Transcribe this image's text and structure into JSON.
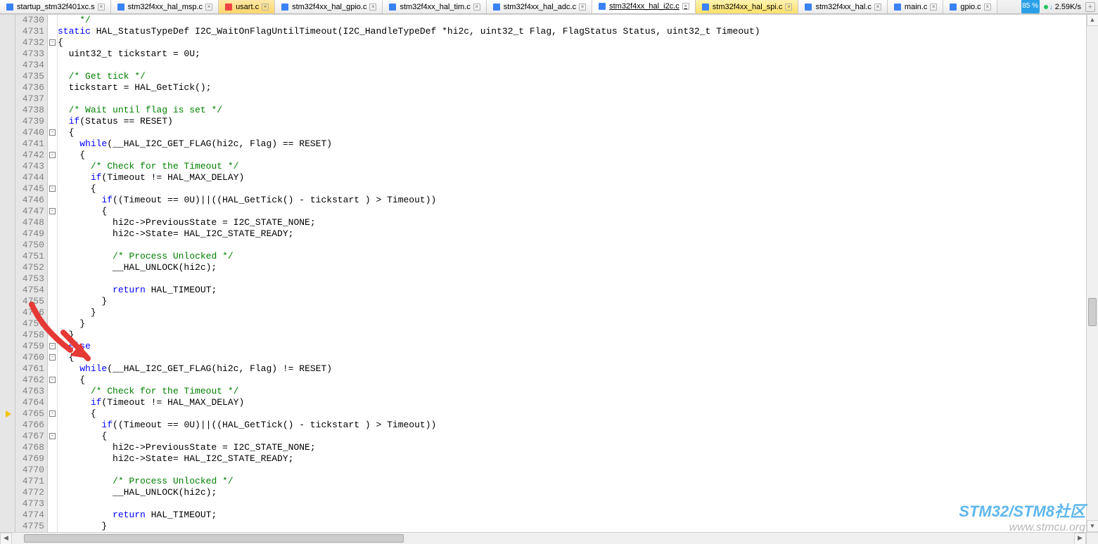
{
  "tabs": [
    {
      "label": "startup_stm32f401xc.s",
      "color": "blue",
      "special": false,
      "active": false
    },
    {
      "label": "stm32f4xx_hal_msp.c",
      "color": "blue",
      "special": false,
      "active": false
    },
    {
      "label": "usart.c",
      "color": "red",
      "special": true,
      "active": false
    },
    {
      "label": "stm32f4xx_hal_gpio.c",
      "color": "blue",
      "special": false,
      "active": false
    },
    {
      "label": "stm32f4xx_hal_tim.c",
      "color": "blue",
      "special": false,
      "active": false
    },
    {
      "label": "stm32f4xx_hal_adc.c",
      "color": "blue",
      "special": false,
      "active": false
    },
    {
      "label": "stm32f4xx_hal_i2c.c",
      "color": "blue",
      "special": false,
      "active": true
    },
    {
      "label": "stm32f4xx_hal_spi.c",
      "color": "blue",
      "special": true,
      "active": false
    },
    {
      "label": "stm32f4xx_hal.c",
      "color": "blue",
      "special": false,
      "active": false
    },
    {
      "label": "main.c",
      "color": "blue",
      "special": false,
      "active": false
    },
    {
      "label": "gpio.c",
      "color": "blue",
      "special": false,
      "active": false
    }
  ],
  "status": {
    "pct": "85 %",
    "speed": "2.59K/s"
  },
  "first_line_number": 4730,
  "breakpoint_line": 4765,
  "fold_lines": [
    4732,
    4740,
    4742,
    4745,
    4747,
    4759,
    4760,
    4762,
    4765,
    4767
  ],
  "code_lines": [
    {
      "n": 4730,
      "raw": "    */",
      "seg": [
        [
          "cmt",
          "    */"
        ]
      ]
    },
    {
      "n": 4731,
      "raw": "static HAL_StatusTypeDef I2C_WaitOnFlagUntilTimeout(I2C_HandleTypeDef *hi2c, uint32_t Flag, FlagStatus Status, uint32_t Timeout)",
      "seg": [
        [
          "kw",
          "static"
        ],
        [
          "cn",
          " HAL_StatusTypeDef I2C_WaitOnFlagUntilTimeout(I2C_HandleTypeDef *hi2c, uint32_t Flag, FlagStatus Status, uint32_t Timeout)"
        ]
      ]
    },
    {
      "n": 4732,
      "raw": "{",
      "seg": [
        [
          "cn",
          "{"
        ]
      ]
    },
    {
      "n": 4733,
      "raw": "  uint32_t tickstart = 0U;",
      "seg": [
        [
          "cn",
          "  uint32_t tickstart = 0U;"
        ]
      ]
    },
    {
      "n": 4734,
      "raw": "",
      "seg": [
        [
          "cn",
          ""
        ]
      ]
    },
    {
      "n": 4735,
      "raw": "  /* Get tick */",
      "seg": [
        [
          "cn",
          "  "
        ],
        [
          "cmt",
          "/* Get tick */"
        ]
      ]
    },
    {
      "n": 4736,
      "raw": "  tickstart = HAL_GetTick();",
      "seg": [
        [
          "cn",
          "  tickstart = HAL_GetTick();"
        ]
      ]
    },
    {
      "n": 4737,
      "raw": "",
      "seg": [
        [
          "cn",
          ""
        ]
      ]
    },
    {
      "n": 4738,
      "raw": "  /* Wait until flag is set */",
      "seg": [
        [
          "cn",
          "  "
        ],
        [
          "cmt",
          "/* Wait until flag is set */"
        ]
      ]
    },
    {
      "n": 4739,
      "raw": "  if(Status == RESET)",
      "seg": [
        [
          "cn",
          "  "
        ],
        [
          "kw",
          "if"
        ],
        [
          "cn",
          "(Status == RESET)"
        ]
      ]
    },
    {
      "n": 4740,
      "raw": "  {",
      "seg": [
        [
          "cn",
          "  {"
        ]
      ]
    },
    {
      "n": 4741,
      "raw": "    while(__HAL_I2C_GET_FLAG(hi2c, Flag) == RESET)",
      "seg": [
        [
          "cn",
          "    "
        ],
        [
          "kw",
          "while"
        ],
        [
          "cn",
          "(__HAL_I2C_GET_FLAG(hi2c, Flag) == RESET)"
        ]
      ]
    },
    {
      "n": 4742,
      "raw": "    {",
      "seg": [
        [
          "cn",
          "    {"
        ]
      ]
    },
    {
      "n": 4743,
      "raw": "      /* Check for the Timeout */",
      "seg": [
        [
          "cn",
          "      "
        ],
        [
          "cmt",
          "/* Check for the Timeout */"
        ]
      ]
    },
    {
      "n": 4744,
      "raw": "      if(Timeout != HAL_MAX_DELAY)",
      "seg": [
        [
          "cn",
          "      "
        ],
        [
          "kw",
          "if"
        ],
        [
          "cn",
          "(Timeout != HAL_MAX_DELAY)"
        ]
      ]
    },
    {
      "n": 4745,
      "raw": "      {",
      "seg": [
        [
          "cn",
          "      {"
        ]
      ]
    },
    {
      "n": 4746,
      "raw": "        if((Timeout == 0U)||((HAL_GetTick() - tickstart ) > Timeout))",
      "seg": [
        [
          "cn",
          "        "
        ],
        [
          "kw",
          "if"
        ],
        [
          "cn",
          "((Timeout == 0U)||((HAL_GetTick() - tickstart ) > Timeout))"
        ]
      ]
    },
    {
      "n": 4747,
      "raw": "        {",
      "seg": [
        [
          "cn",
          "        {"
        ]
      ]
    },
    {
      "n": 4748,
      "raw": "          hi2c->PreviousState = I2C_STATE_NONE;",
      "seg": [
        [
          "cn",
          "          hi2c->PreviousState = I2C_STATE_NONE;"
        ]
      ]
    },
    {
      "n": 4749,
      "raw": "          hi2c->State= HAL_I2C_STATE_READY;",
      "seg": [
        [
          "cn",
          "          hi2c->State= HAL_I2C_STATE_READY;"
        ]
      ]
    },
    {
      "n": 4750,
      "raw": "",
      "seg": [
        [
          "cn",
          ""
        ]
      ]
    },
    {
      "n": 4751,
      "raw": "          /* Process Unlocked */",
      "seg": [
        [
          "cn",
          "          "
        ],
        [
          "cmt",
          "/* Process Unlocked */"
        ]
      ]
    },
    {
      "n": 4752,
      "raw": "          __HAL_UNLOCK(hi2c);",
      "seg": [
        [
          "cn",
          "          __HAL_UNLOCK(hi2c);"
        ]
      ]
    },
    {
      "n": 4753,
      "raw": "",
      "seg": [
        [
          "cn",
          ""
        ]
      ]
    },
    {
      "n": 4754,
      "raw": "          return HAL_TIMEOUT;",
      "seg": [
        [
          "cn",
          "          "
        ],
        [
          "kw",
          "return"
        ],
        [
          "cn",
          " HAL_TIMEOUT;"
        ]
      ]
    },
    {
      "n": 4755,
      "raw": "        }",
      "seg": [
        [
          "cn",
          "        }"
        ]
      ]
    },
    {
      "n": 4756,
      "raw": "      }",
      "seg": [
        [
          "cn",
          "      }"
        ]
      ]
    },
    {
      "n": 4757,
      "raw": "    }",
      "seg": [
        [
          "cn",
          "    }"
        ]
      ]
    },
    {
      "n": 4758,
      "raw": "  }",
      "seg": [
        [
          "cn",
          "  }"
        ]
      ]
    },
    {
      "n": 4759,
      "raw": "  else",
      "seg": [
        [
          "cn",
          "  "
        ],
        [
          "kw",
          "else"
        ]
      ]
    },
    {
      "n": 4760,
      "raw": "  {",
      "seg": [
        [
          "cn",
          "  {"
        ]
      ]
    },
    {
      "n": 4761,
      "raw": "    while(__HAL_I2C_GET_FLAG(hi2c, Flag) != RESET)",
      "seg": [
        [
          "cn",
          "    "
        ],
        [
          "kw",
          "while"
        ],
        [
          "cn",
          "(__HAL_I2C_GET_FLAG(hi2c, Flag) != RESET)"
        ]
      ]
    },
    {
      "n": 4762,
      "raw": "    {",
      "seg": [
        [
          "cn",
          "    {"
        ]
      ]
    },
    {
      "n": 4763,
      "raw": "      /* Check for the Timeout */",
      "seg": [
        [
          "cn",
          "      "
        ],
        [
          "cmt",
          "/* Check for the Timeout */"
        ]
      ]
    },
    {
      "n": 4764,
      "raw": "      if(Timeout != HAL_MAX_DELAY)",
      "seg": [
        [
          "cn",
          "      "
        ],
        [
          "kw",
          "if"
        ],
        [
          "cn",
          "(Timeout != HAL_MAX_DELAY)"
        ]
      ]
    },
    {
      "n": 4765,
      "raw": "      {",
      "seg": [
        [
          "cn",
          "      {"
        ]
      ]
    },
    {
      "n": 4766,
      "raw": "        if((Timeout == 0U)||((HAL_GetTick() - tickstart ) > Timeout))",
      "seg": [
        [
          "cn",
          "        "
        ],
        [
          "kw",
          "if"
        ],
        [
          "cn",
          "((Timeout == 0U)||((HAL_GetTick() - tickstart ) > Timeout))"
        ]
      ]
    },
    {
      "n": 4767,
      "raw": "        {",
      "seg": [
        [
          "cn",
          "        {"
        ]
      ]
    },
    {
      "n": 4768,
      "raw": "          hi2c->PreviousState = I2C_STATE_NONE;",
      "seg": [
        [
          "cn",
          "          hi2c->PreviousState = I2C_STATE_NONE;"
        ]
      ]
    },
    {
      "n": 4769,
      "raw": "          hi2c->State= HAL_I2C_STATE_READY;",
      "seg": [
        [
          "cn",
          "          hi2c->State= HAL_I2C_STATE_READY;"
        ]
      ]
    },
    {
      "n": 4770,
      "raw": "",
      "seg": [
        [
          "cn",
          ""
        ]
      ]
    },
    {
      "n": 4771,
      "raw": "          /* Process Unlocked */",
      "seg": [
        [
          "cn",
          "          "
        ],
        [
          "cmt",
          "/* Process Unlocked */"
        ]
      ]
    },
    {
      "n": 4772,
      "raw": "          __HAL_UNLOCK(hi2c);",
      "seg": [
        [
          "cn",
          "          __HAL_UNLOCK(hi2c);"
        ]
      ]
    },
    {
      "n": 4773,
      "raw": "",
      "seg": [
        [
          "cn",
          ""
        ]
      ]
    },
    {
      "n": 4774,
      "raw": "          return HAL_TIMEOUT;",
      "seg": [
        [
          "cn",
          "          "
        ],
        [
          "kw",
          "return"
        ],
        [
          "cn",
          " HAL_TIMEOUT;"
        ]
      ]
    },
    {
      "n": 4775,
      "raw": "        }",
      "seg": [
        [
          "cn",
          "        }"
        ]
      ]
    }
  ],
  "watermark": {
    "line1": "STM32/STM8社区",
    "line2": "www.stmcu.org"
  }
}
